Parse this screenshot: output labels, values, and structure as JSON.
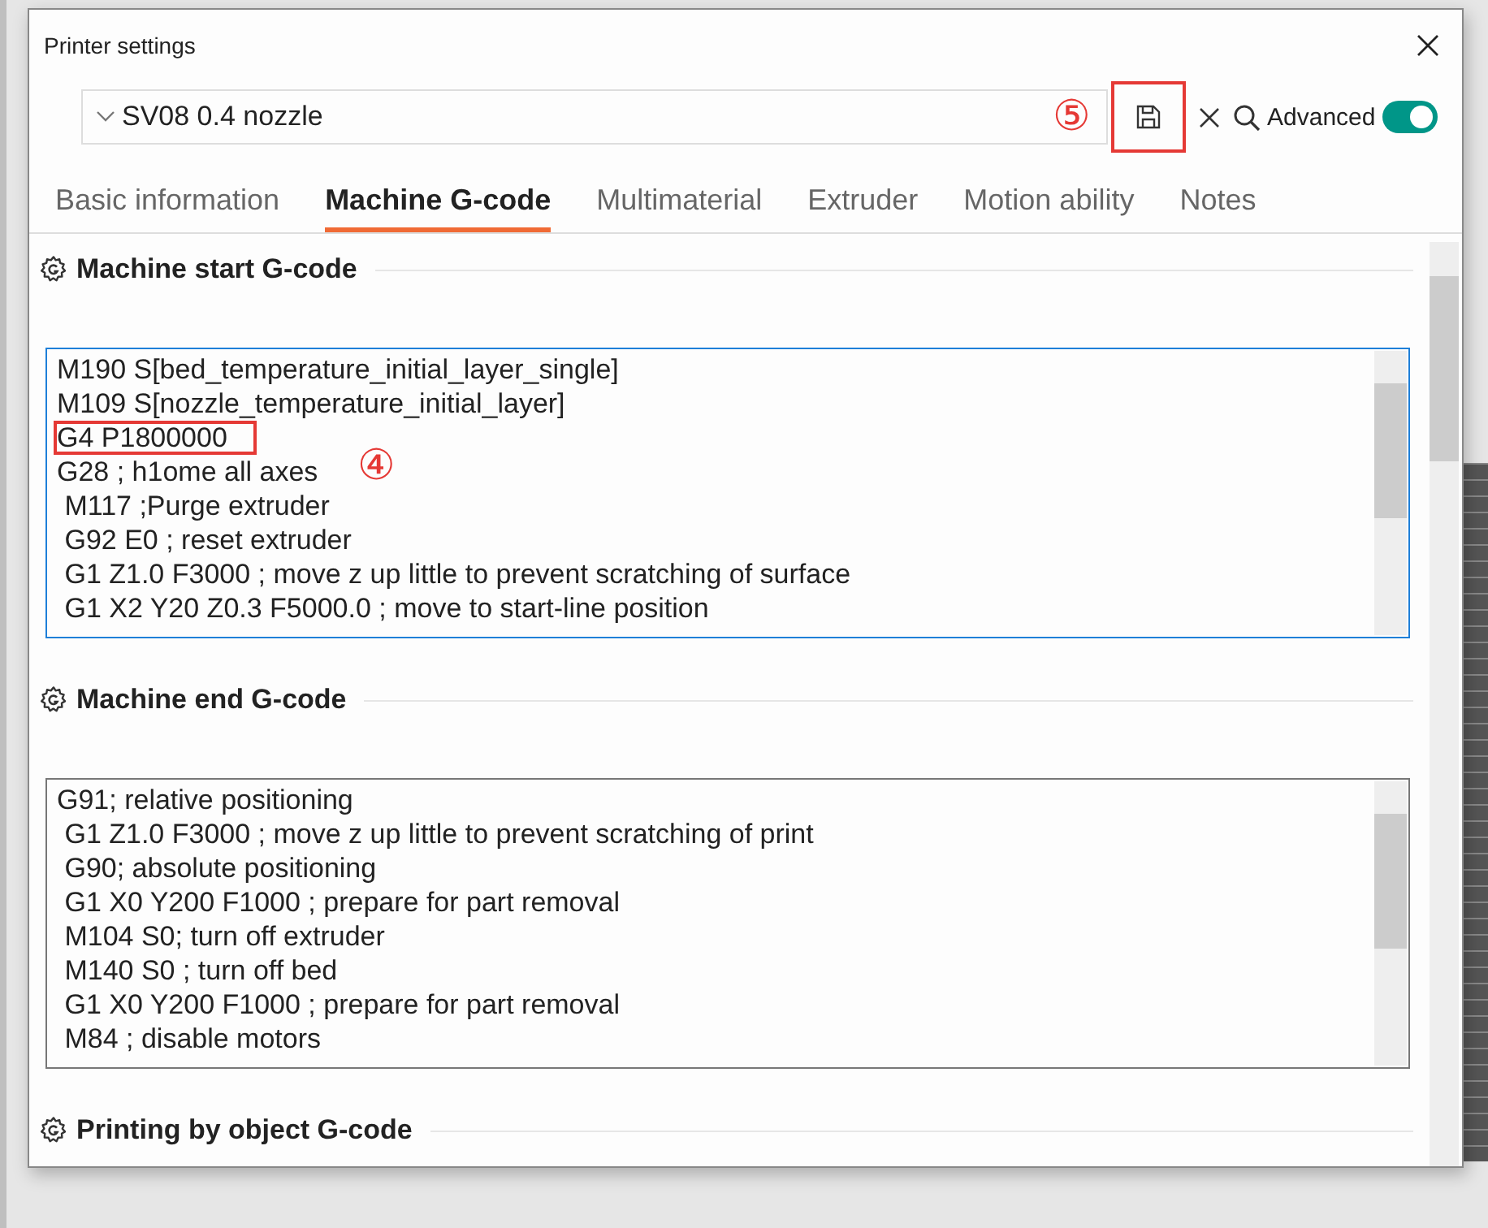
{
  "window": {
    "title": "Printer settings"
  },
  "toolbar": {
    "preset": "SV08 0.4 nozzle",
    "save": {
      "highlighted": true,
      "marker": "⑤"
    },
    "advanced": {
      "label": "Advanced",
      "on": true
    }
  },
  "tabs": [
    {
      "label": "Basic information",
      "selected": false
    },
    {
      "label": "Machine G-code",
      "selected": true
    },
    {
      "label": "Multimaterial",
      "selected": false
    },
    {
      "label": "Extruder",
      "selected": false
    },
    {
      "label": "Motion ability",
      "selected": false
    },
    {
      "label": "Notes",
      "selected": false
    }
  ],
  "sections": [
    {
      "title": "Machine start G-code",
      "editor": {
        "focused": true,
        "lines": [
          {
            "text": "M190 S[bed_temperature_initial_layer_single]",
            "highlighted": false
          },
          {
            "text": "M109 S[nozzle_temperature_initial_layer]",
            "highlighted": false
          },
          {
            "text": "G4 P1800000",
            "highlighted": true,
            "marker": "④"
          },
          {
            "text": "G28 ; h1ome all axes",
            "highlighted": false
          },
          {
            "text": " M117 ;Purge extruder",
            "highlighted": false
          },
          {
            "text": " G92 E0 ; reset extruder",
            "highlighted": false
          },
          {
            "text": " G1 Z1.0 F3000 ; move z up little to prevent scratching of surface",
            "highlighted": false
          },
          {
            "text": " G1 X2 Y20 Z0.3 F5000.0 ; move to start-line position",
            "highlighted": false
          }
        ]
      }
    },
    {
      "title": "Machine end G-code",
      "editor": {
        "focused": false,
        "lines": [
          {
            "text": "G91; relative positioning",
            "highlighted": false
          },
          {
            "text": " G1 Z1.0 F3000 ; move z up little to prevent scratching of print",
            "highlighted": false
          },
          {
            "text": " G90; absolute positioning",
            "highlighted": false
          },
          {
            "text": " G1 X0 Y200 F1000 ; prepare for part removal",
            "highlighted": false
          },
          {
            "text": " M104 S0; turn off extruder",
            "highlighted": false
          },
          {
            "text": " M140 S0 ; turn off bed",
            "highlighted": false
          },
          {
            "text": " G1 X0 Y200 F1000 ; prepare for part removal",
            "highlighted": false
          },
          {
            "text": " M84 ; disable motors",
            "highlighted": false
          }
        ]
      }
    },
    {
      "title": "Printing by object G-code"
    }
  ]
}
